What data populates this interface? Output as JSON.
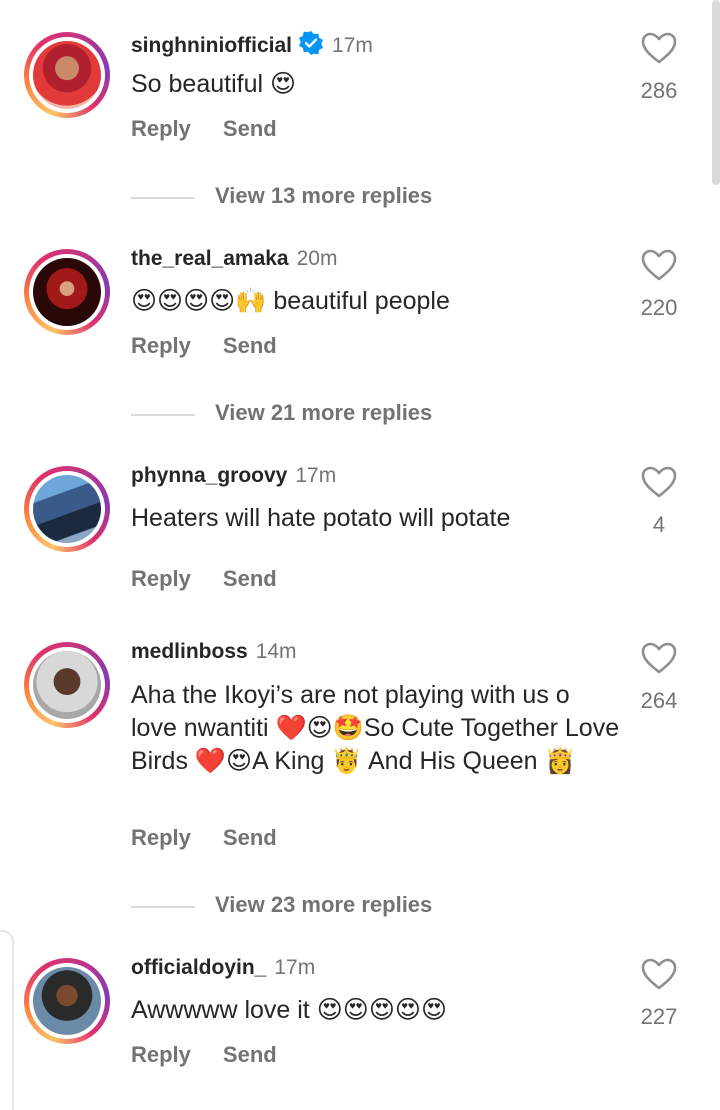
{
  "comments": [
    {
      "username": "singhniniofficial",
      "verified": true,
      "time": "17m",
      "text": "So beautiful 😍",
      "reply_label": "Reply",
      "send_label": "Send",
      "likes": "286",
      "view_replies": "View 13 more replies"
    },
    {
      "username": "the_real_amaka",
      "verified": false,
      "time": "20m",
      "text": "😍😍😍😍🙌 beautiful people",
      "reply_label": "Reply",
      "send_label": "Send",
      "likes": "220",
      "view_replies": "View 21 more replies"
    },
    {
      "username": "phynna_groovy",
      "verified": false,
      "time": "17m",
      "text": "Heaters will hate potato will potate",
      "reply_label": "Reply",
      "send_label": "Send",
      "likes": "4"
    },
    {
      "username": "medlinboss",
      "verified": false,
      "time": "14m",
      "text": "Aha the Ikoyi’s are not playing with us o love nwantiti ❤️😍🤩So Cute Together Love Birds ❤️😍A King 🤴 And His Queen 👸",
      "reply_label": "Reply",
      "send_label": "Send",
      "likes": "264",
      "view_replies": "View 23 more replies"
    },
    {
      "username": "officialdoyin_",
      "verified": false,
      "time": "17m",
      "text": "Awwwww love it 😍😍😍😍😍",
      "reply_label": "Reply",
      "send_label": "Send",
      "likes": "227"
    }
  ],
  "icons": {
    "heart": "heart-outline-icon",
    "verified": "verified-badge-icon"
  },
  "colors": {
    "verified_blue": "#0095f6",
    "secondary_text": "#737373"
  }
}
